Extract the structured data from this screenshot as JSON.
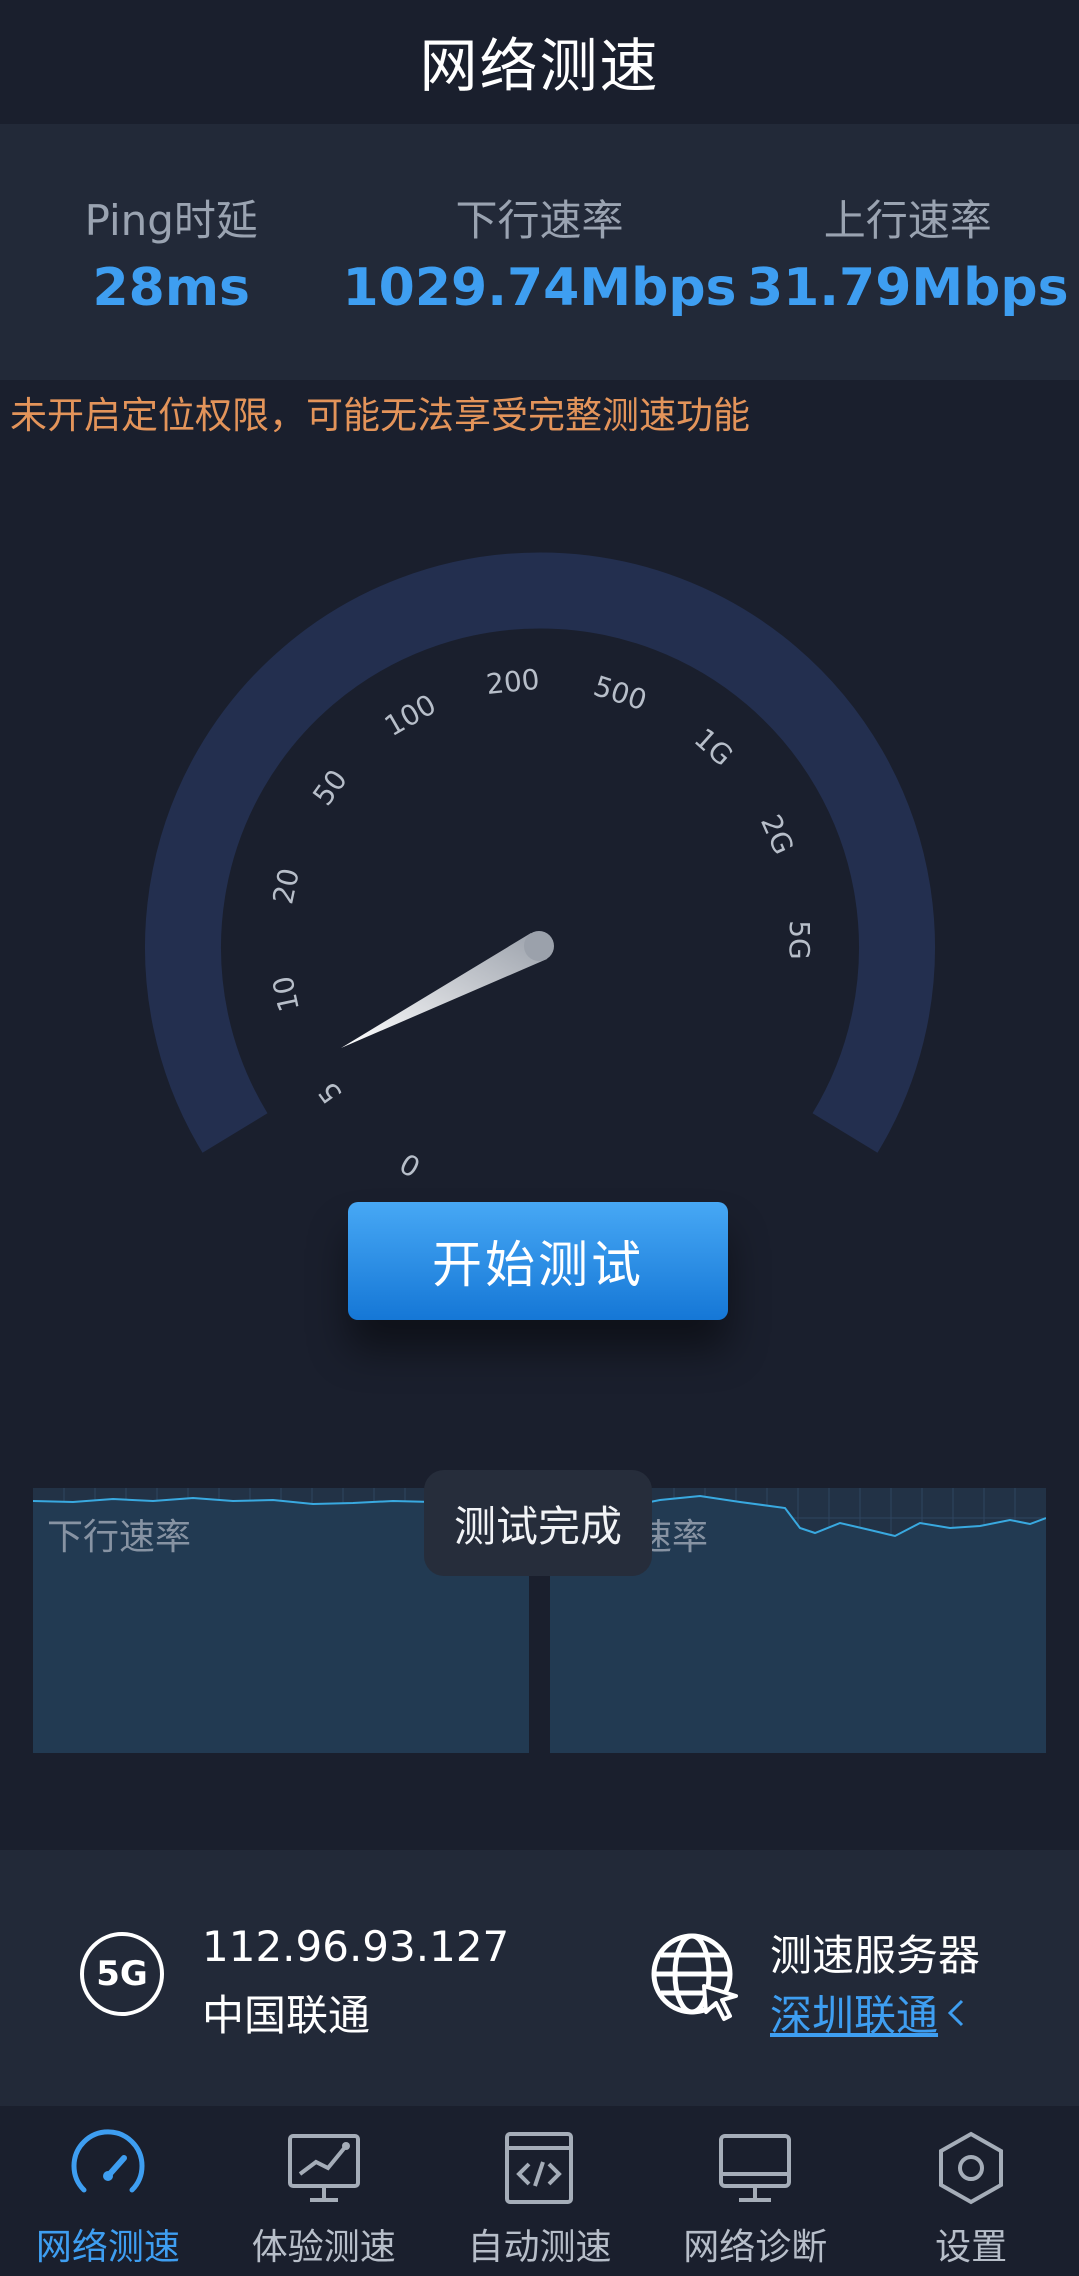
{
  "header": {
    "title": "网络测速"
  },
  "stats": [
    {
      "label": "Ping时延",
      "value": "28ms"
    },
    {
      "label": "下行速率",
      "value": "1029.74Mbps"
    },
    {
      "label": "上行速率",
      "value": "31.79Mbps"
    }
  ],
  "warning": "未开启定位权限，可能无法享受完整测速功能",
  "gauge": {
    "scale_labels": [
      "0",
      "5",
      "10",
      "20",
      "50",
      "100",
      "200",
      "500",
      "1G",
      "2G",
      "5G"
    ],
    "needle_value_fraction": 0.05
  },
  "start_button": {
    "label": "开始测试"
  },
  "graphs": {
    "download_label": "下行速率",
    "upload_label": "上行速率",
    "toast": "测试完成"
  },
  "network": {
    "type": "5G",
    "ip": "112.96.93.127",
    "isp": "中国联通"
  },
  "server": {
    "label": "测速服务器",
    "name": "深圳联通"
  },
  "nav": [
    {
      "label": "网络测速",
      "icon": "speedometer-icon",
      "active": true
    },
    {
      "label": "体验测速",
      "icon": "monitor-chart-icon",
      "active": false
    },
    {
      "label": "自动测速",
      "icon": "code-window-icon",
      "active": false
    },
    {
      "label": "网络诊断",
      "icon": "desktop-icon",
      "active": false
    },
    {
      "label": "设置",
      "icon": "hexagon-settings-icon",
      "active": false
    }
  ],
  "colors": {
    "accent": "#3e9ef1",
    "background": "#1a1f2d",
    "panel": "#222938",
    "warning": "#e3945a",
    "gauge_arc": "#232f4f",
    "graph_line": "#39a9e0"
  }
}
